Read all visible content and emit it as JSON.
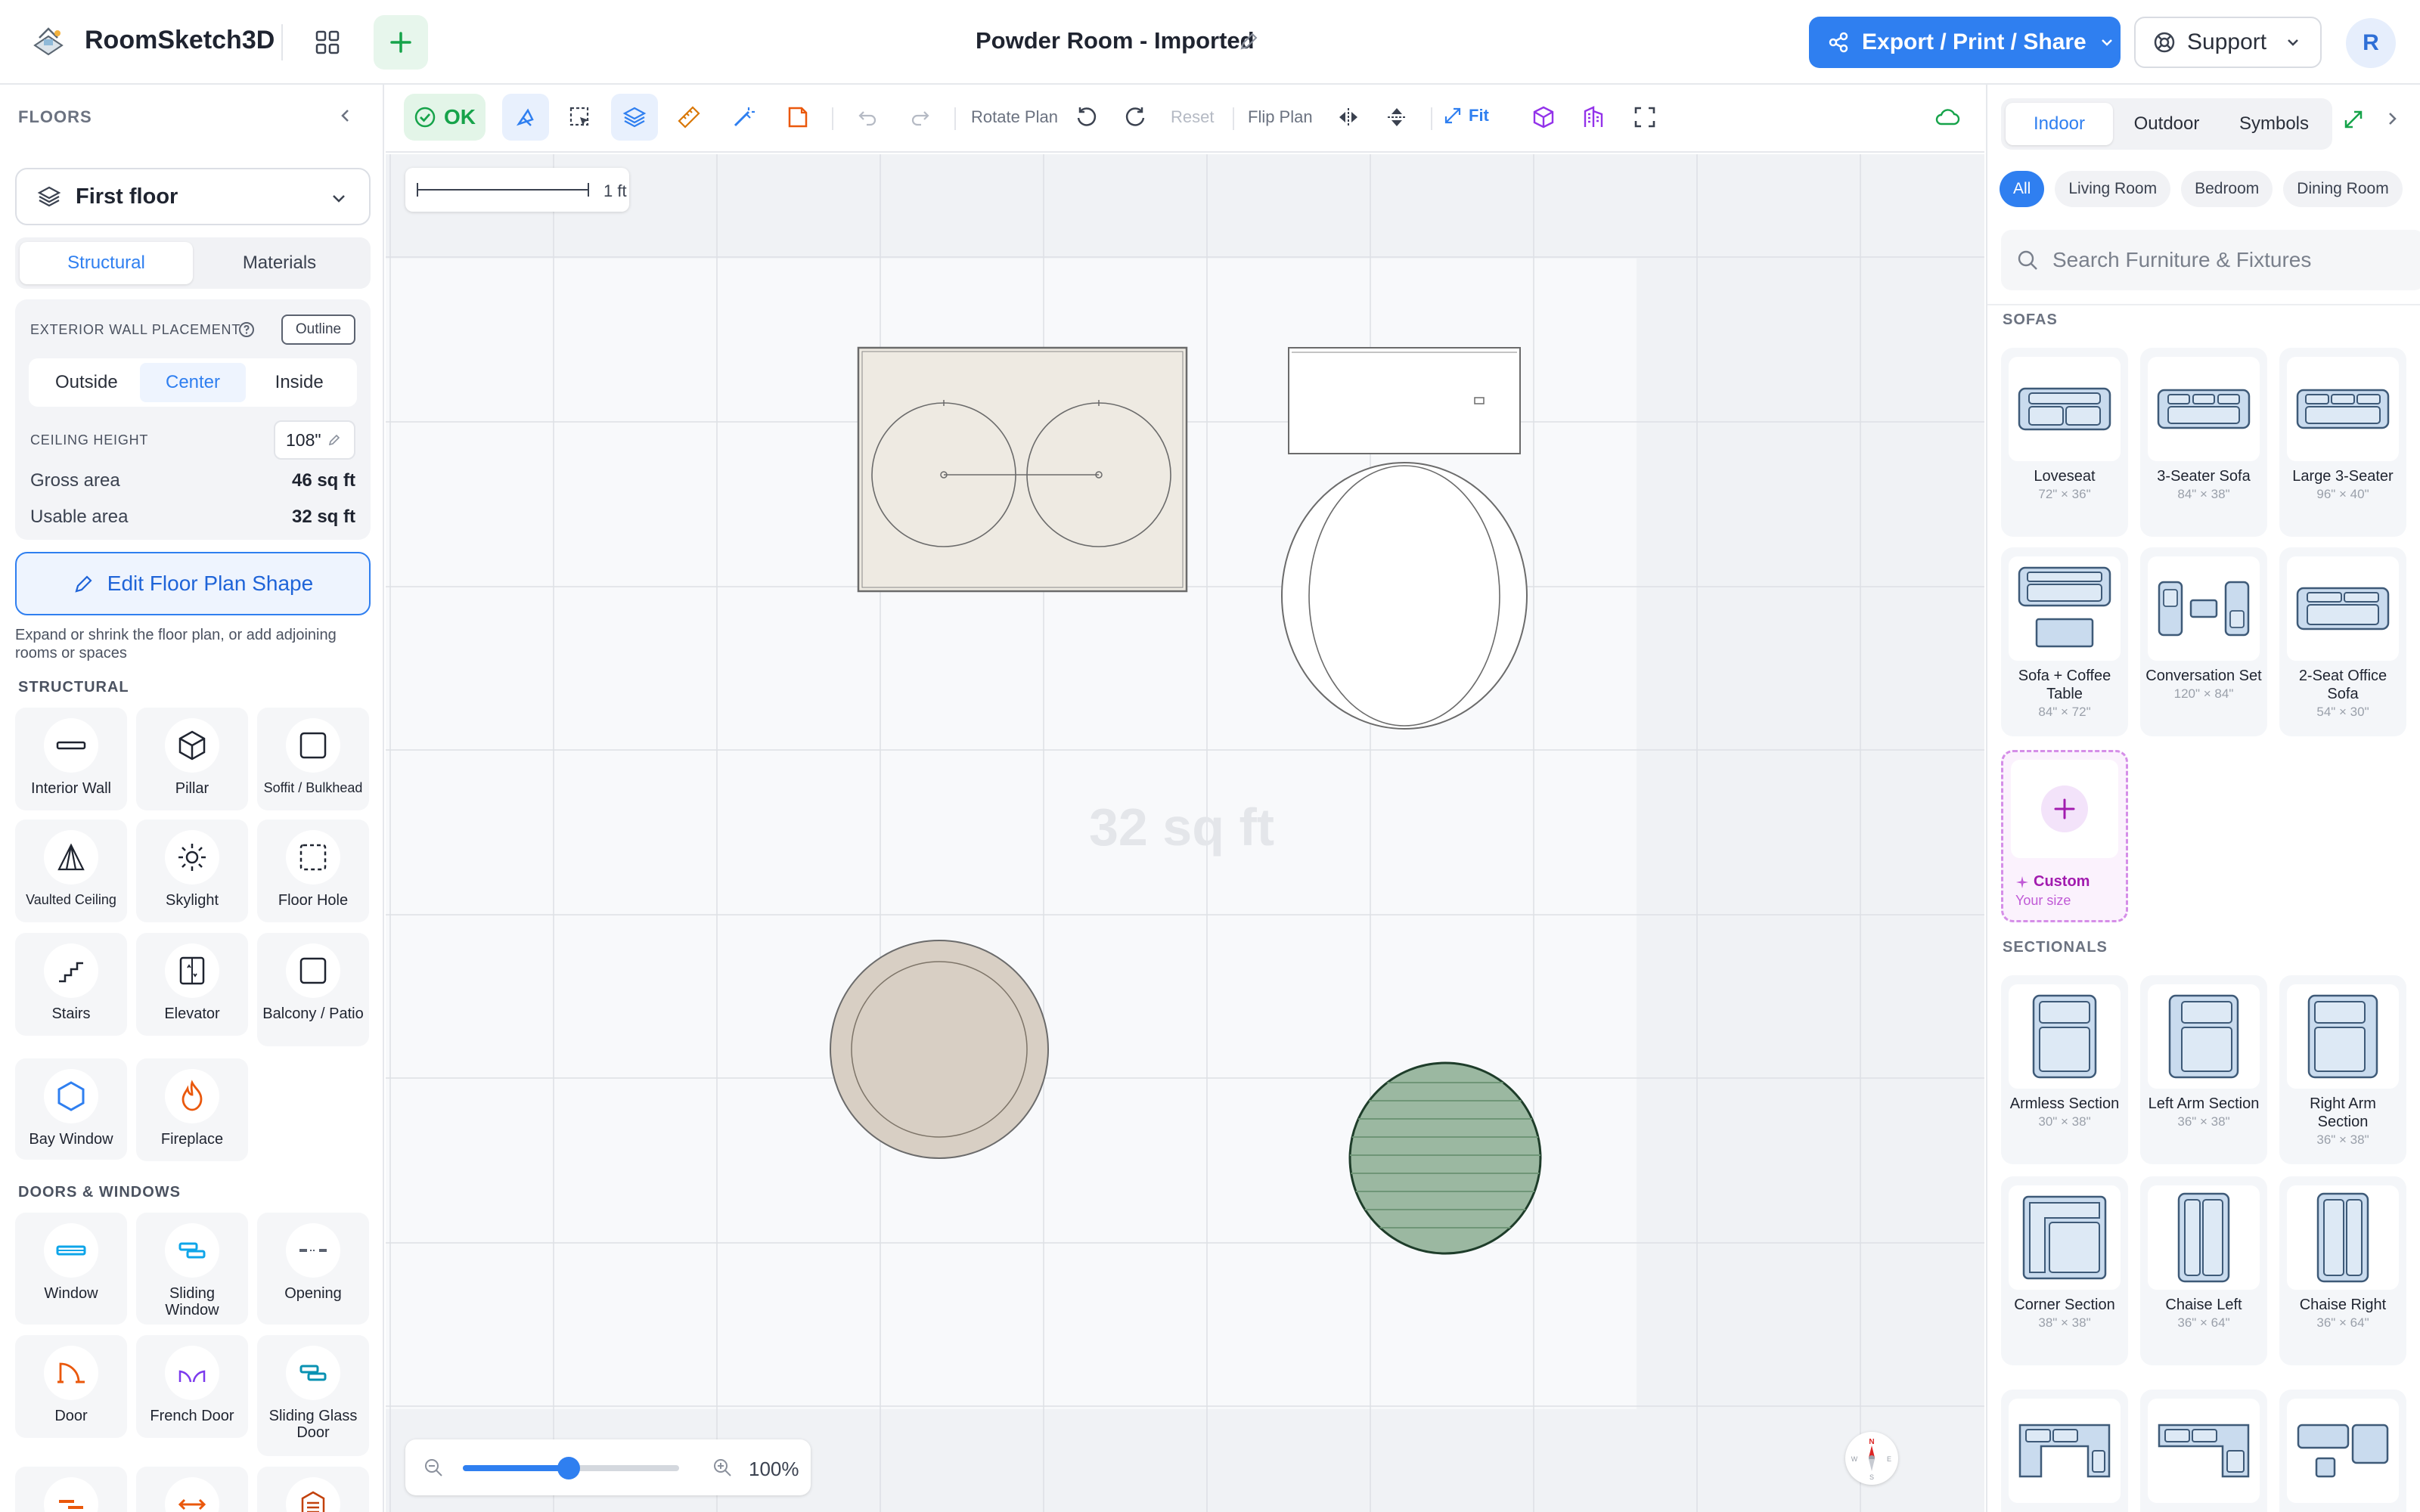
{
  "app": {
    "name": "RoomSketch3D",
    "document_title": "Powder Room - Imported",
    "export_label": "Export / Print / Share",
    "support_label": "Support",
    "avatar_initial": "R",
    "accent_color": "#2f7ff0"
  },
  "left_panel": {
    "heading": "FLOORS",
    "floor_selected": "First floor",
    "tabs": [
      "Structural",
      "Materials"
    ],
    "active_tab": "Structural",
    "exterior_wall_label": "EXTERIOR WALL PLACEMENT",
    "outline_label": "Outline",
    "wall_options": [
      "Outside",
      "Center",
      "Inside"
    ],
    "wall_selected": "Center",
    "ceiling_label": "CEILING HEIGHT",
    "ceiling_value": "108\"",
    "gross_label": "Gross area",
    "gross_value": "46 sq ft",
    "usable_label": "Usable area",
    "usable_value": "32 sq ft",
    "edit_shape_label": "Edit Floor Plan Shape",
    "edit_shape_help": "Expand or shrink the floor plan, or add adjoining rooms or spaces",
    "structural_heading": "STRUCTURAL",
    "structural_items": [
      {
        "label": "Interior Wall",
        "icon": "interior-wall-icon"
      },
      {
        "label": "Pillar",
        "icon": "pillar-icon"
      },
      {
        "label": "Soffit / Bulkhead",
        "icon": "soffit-icon"
      },
      {
        "label": "Vaulted Ceiling",
        "icon": "vaulted-ceiling-icon"
      },
      {
        "label": "Skylight",
        "icon": "skylight-icon"
      },
      {
        "label": "Floor Hole",
        "icon": "floor-hole-icon"
      },
      {
        "label": "Stairs",
        "icon": "stairs-icon"
      },
      {
        "label": "Elevator",
        "icon": "elevator-icon"
      },
      {
        "label": "Balcony / Patio",
        "icon": "balcony-icon"
      },
      {
        "label": "Bay Window",
        "icon": "bay-window-icon"
      },
      {
        "label": "Fireplace",
        "icon": "fireplace-icon"
      }
    ],
    "doors_heading": "DOORS & WINDOWS",
    "door_items": [
      {
        "label": "Window",
        "icon": "window-icon"
      },
      {
        "label": "Sliding Window",
        "icon": "sliding-window-icon"
      },
      {
        "label": "Opening",
        "icon": "opening-icon"
      },
      {
        "label": "Door",
        "icon": "door-icon"
      },
      {
        "label": "French Door",
        "icon": "french-door-icon"
      },
      {
        "label": "Sliding Glass Door",
        "icon": "sliding-glass-door-icon"
      }
    ]
  },
  "toolbar": {
    "status": "OK",
    "rotate_label": "Rotate Plan",
    "reset_label": "Reset",
    "flip_label": "Flip Plan",
    "fit_label": "Fit"
  },
  "canvas": {
    "scale_label": "1 ft",
    "area_watermark": "32 sq ft",
    "zoom_percent": 100,
    "zoom_label": "100%",
    "zoom_slider_fraction": 0.49
  },
  "right_panel": {
    "tabs": [
      "Indoor",
      "Outdoor",
      "Symbols"
    ],
    "active_tab": "Indoor",
    "chips": [
      "All",
      "Living Room",
      "Bedroom",
      "Dining Room"
    ],
    "active_chip": "All",
    "search_placeholder": "Search Furniture & Fixtures",
    "sofas_heading": "SOFAS",
    "sofas": [
      {
        "name": "Loveseat",
        "dims": "72\" × 36\""
      },
      {
        "name": "3-Seater Sofa",
        "dims": "84\" × 38\""
      },
      {
        "name": "Large 3-Seater",
        "dims": "96\" × 40\""
      },
      {
        "name": "Sofa + Coffee Table",
        "dims": "84\" × 72\""
      },
      {
        "name": "Conversation Set",
        "dims": "120\" × 84\""
      },
      {
        "name": "2-Seat Office Sofa",
        "dims": "54\" × 30\""
      }
    ],
    "custom_label": "Custom",
    "custom_sub": "Your size",
    "sectionals_heading": "SECTIONALS",
    "sectionals": [
      {
        "name": "Armless Section",
        "dims": "30\" × 38\""
      },
      {
        "name": "Left Arm Section",
        "dims": "36\" × 38\""
      },
      {
        "name": "Right Arm Section",
        "dims": "36\" × 38\""
      },
      {
        "name": "Corner Section",
        "dims": "38\" × 38\""
      },
      {
        "name": "Chaise Left",
        "dims": "36\" × 64\""
      },
      {
        "name": "Chaise Right",
        "dims": "36\" × 64\""
      }
    ]
  }
}
